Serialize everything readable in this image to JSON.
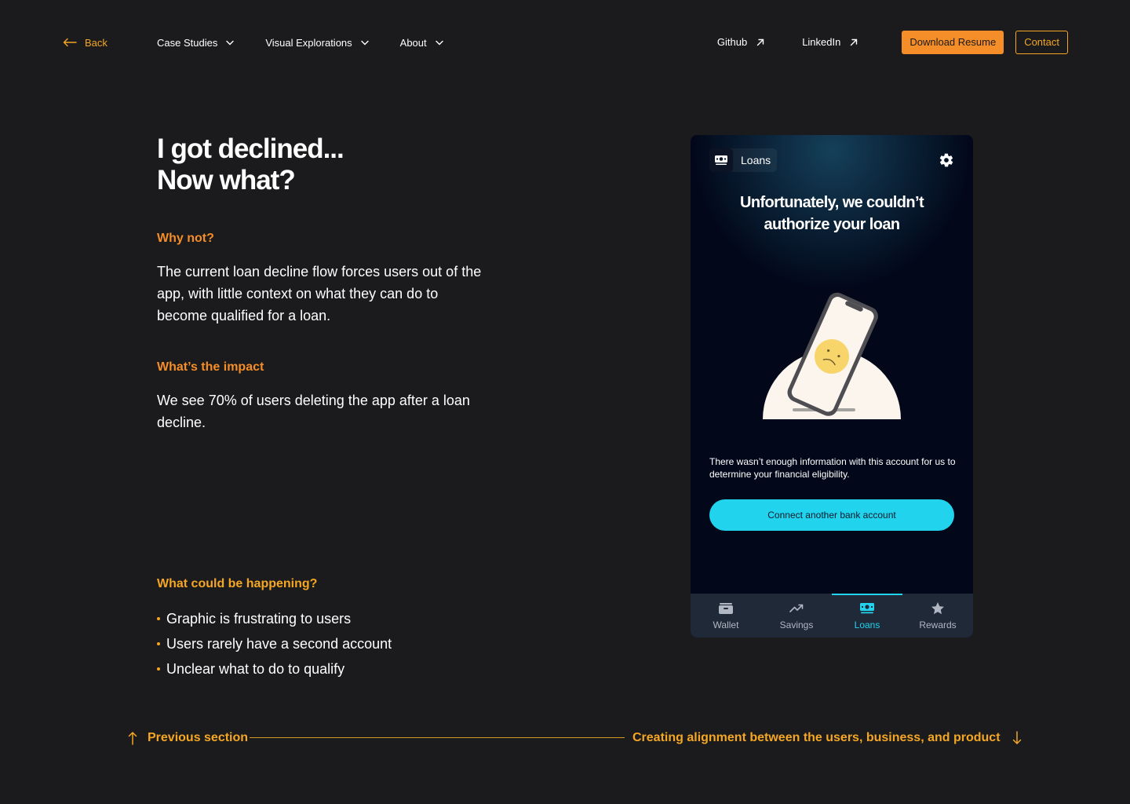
{
  "nav": {
    "back_label": "Back",
    "menu": [
      {
        "label": "Case Studies"
      },
      {
        "label": "Visual Explorations"
      },
      {
        "label": "About"
      }
    ],
    "github_label": "Github",
    "linkedin_label": "LinkedIn",
    "resume_label": "Download Resume",
    "contact_label": "Contact"
  },
  "main": {
    "headline_line1": "I got declined...",
    "headline_line2": "Now what?",
    "why_label": "Why not?",
    "why_text": "The current loan decline flow forces users out of the app, with little context on what they can do to become qualified for a loan.",
    "impact_label": "What’s the impact",
    "impact_text": "We see 70% of users deleting the app after a loan decline.",
    "happening_label": "What could be happening?",
    "bullets": [
      "Graphic is frustrating to users",
      "Users rarely have a second account",
      "Unclear what to do to qualify"
    ]
  },
  "phone": {
    "pill_label": "Loans",
    "title": "Unfortunately, we couldn’t authorize your loan",
    "description": "There wasn’t enough information with this account for us to determine your financial eligibility.",
    "cta_label": "Connect another bank account",
    "tabs": [
      {
        "label": "Wallet",
        "icon": "wallet-icon",
        "active": false
      },
      {
        "label": "Savings",
        "icon": "trend-up-icon",
        "active": false
      },
      {
        "label": "Loans",
        "icon": "money-icon",
        "active": true
      },
      {
        "label": "Rewards",
        "icon": "star-icon",
        "active": false
      }
    ]
  },
  "footer": {
    "previous_label": "Previous section",
    "next_label": "Creating alignment between the users, business, and product"
  },
  "colors": {
    "background": "#1b1b1d",
    "accent_orange": "#f58d28",
    "accent_yellow": "#f5a623",
    "cyan": "#22d3ee"
  }
}
